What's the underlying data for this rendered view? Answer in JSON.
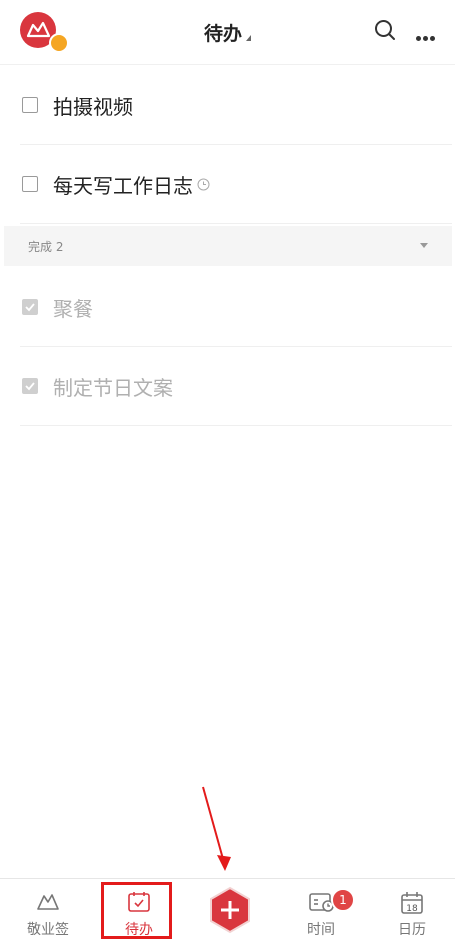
{
  "header": {
    "title": "待办",
    "icons": [
      "avatar-logo",
      "search-icon",
      "more-icon"
    ]
  },
  "tasks": [
    {
      "label": "拍摄视频",
      "done": false
    },
    {
      "label": "每天写工作日志",
      "done": false,
      "has_reminder": true
    }
  ],
  "completed_section": {
    "label": "完成 2"
  },
  "completed": [
    {
      "label": "聚餐",
      "done": true
    },
    {
      "label": "制定节日文案",
      "done": true
    }
  ],
  "tabbar": {
    "items": [
      {
        "label": "敬业签"
      },
      {
        "label": "待办",
        "active": true
      },
      {
        "label": ""
      },
      {
        "label": "时间",
        "badge": "1"
      },
      {
        "label": "日历",
        "icon_text": "18"
      }
    ]
  },
  "colors": {
    "accent": "#d9363e",
    "highlight_annotation": "#e31b1b"
  }
}
